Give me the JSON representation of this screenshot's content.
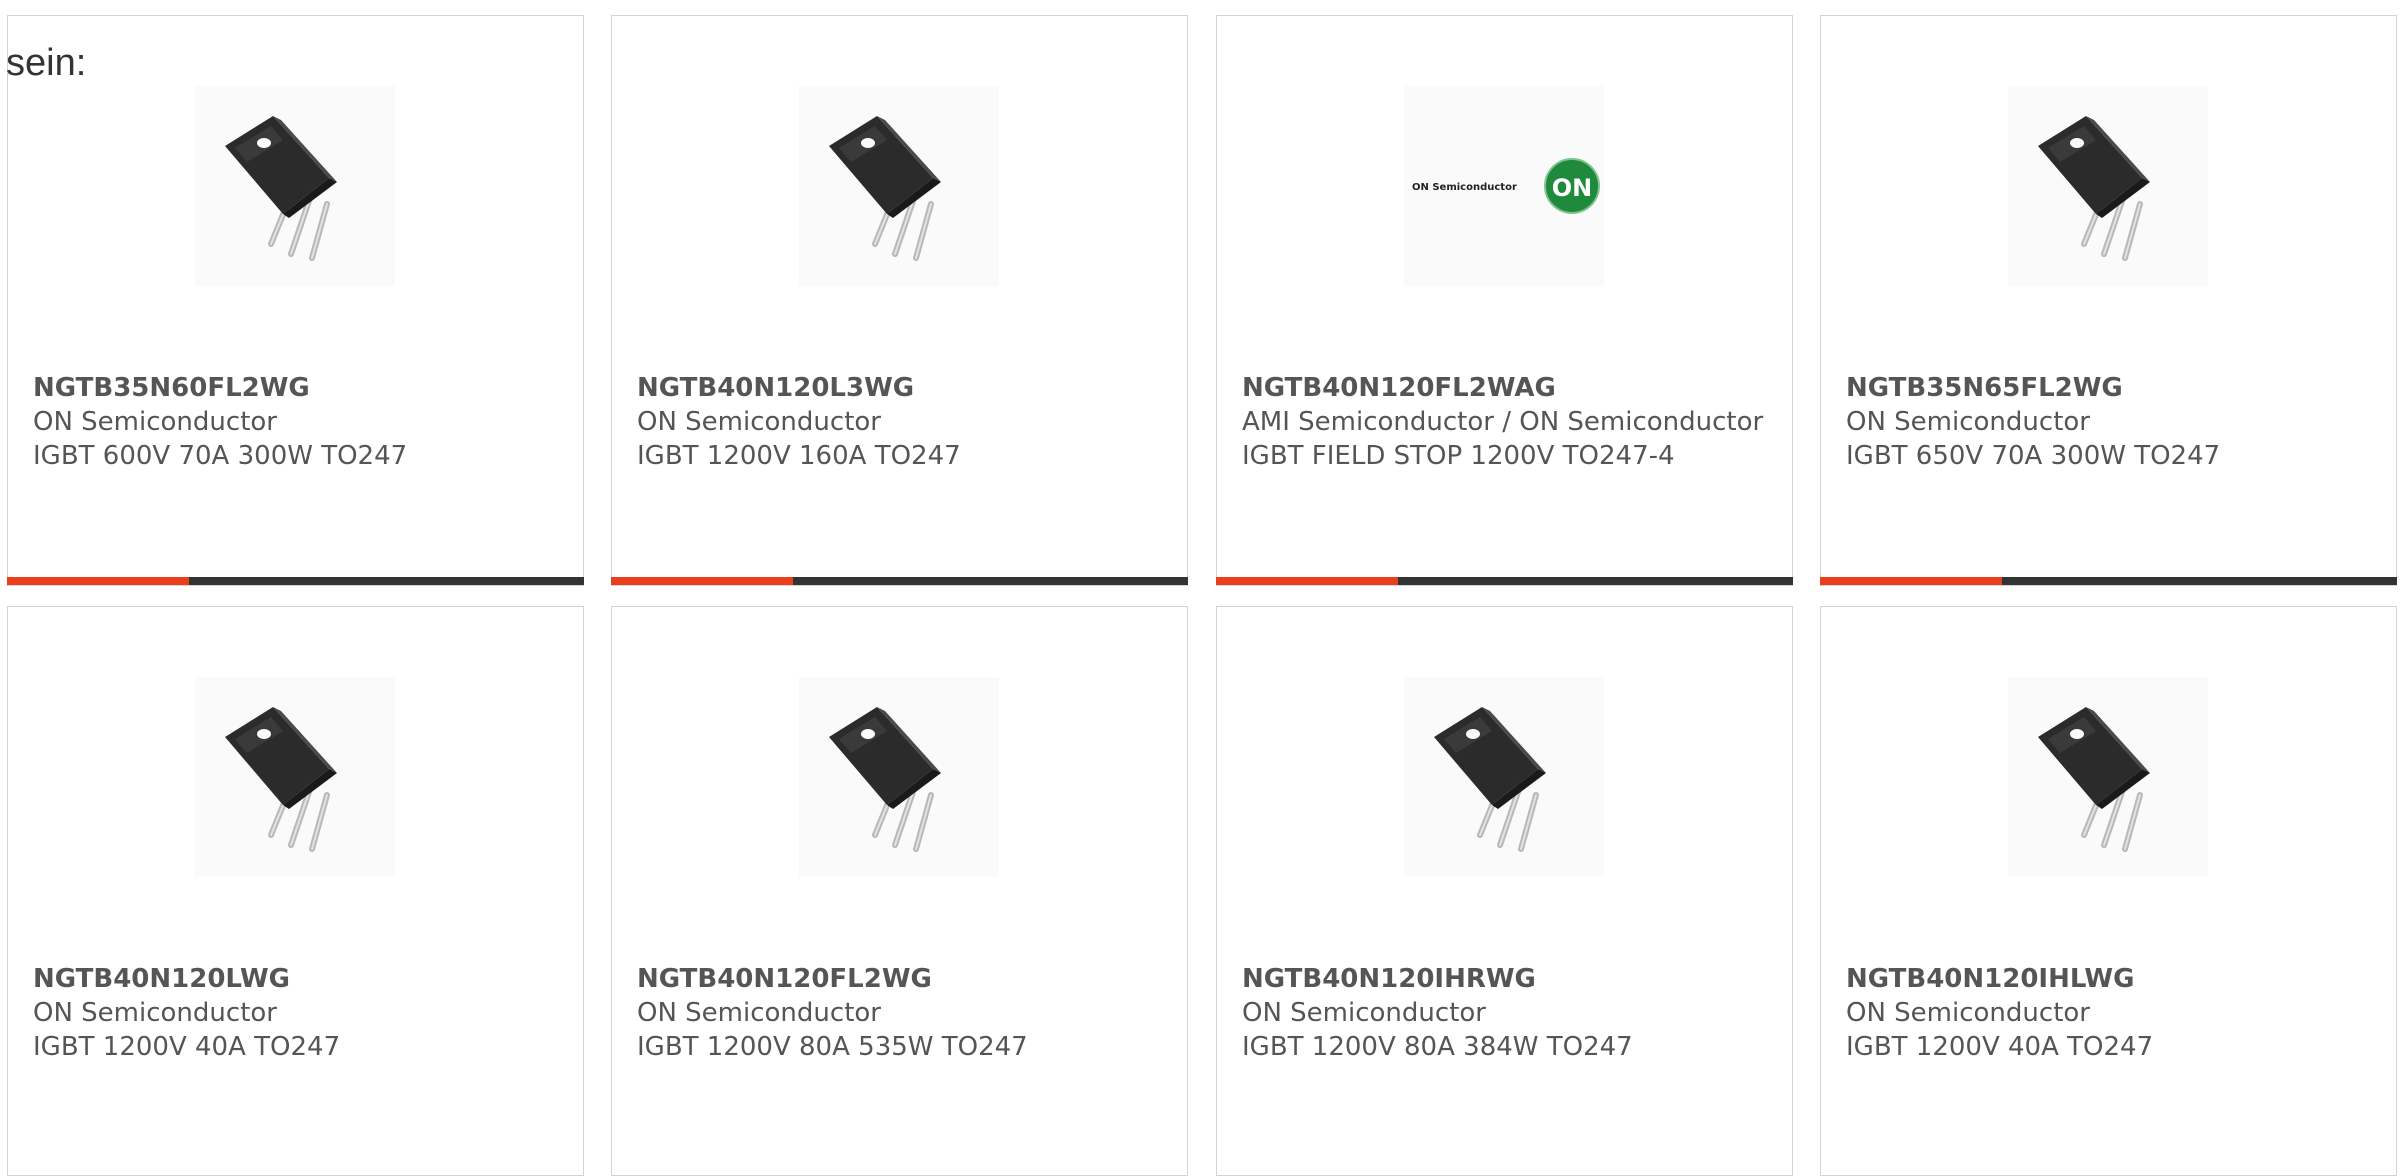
{
  "page": {
    "lead_text": "sein:"
  },
  "colors": {
    "accent": "#e8401c",
    "bar_dark": "#333333",
    "text": "#555555",
    "border": "#d3d3d3",
    "on_logo_green": "#1f8a3c"
  },
  "cards": [
    {
      "part_number": "NGTB35N60FL2WG",
      "manufacturer": "ON Semiconductor",
      "description": "IGBT 600V 70A 300W TO247",
      "image": "to247-transistor-icon"
    },
    {
      "part_number": "NGTB40N120L3WG",
      "manufacturer": "ON Semiconductor",
      "description": "IGBT 1200V 160A TO247",
      "image": "to247-transistor-icon"
    },
    {
      "part_number": "NGTB40N120FL2WAG",
      "manufacturer": "AMI Semiconductor / ON Semiconductor",
      "description": "IGBT FIELD STOP 1200V TO247-4",
      "image": "on-semiconductor-logo",
      "logo_text": "ON Semiconductor",
      "logo_badge": "ON"
    },
    {
      "part_number": "NGTB35N65FL2WG",
      "manufacturer": "ON Semiconductor",
      "description": "IGBT 650V 70A 300W TO247",
      "image": "to247-transistor-icon"
    },
    {
      "part_number": "NGTB40N120LWG",
      "manufacturer": "ON Semiconductor",
      "description": "IGBT 1200V 40A TO247",
      "image": "to247-transistor-icon"
    },
    {
      "part_number": "NGTB40N120FL2WG",
      "manufacturer": "ON Semiconductor",
      "description": "IGBT 1200V 80A 535W TO247",
      "image": "to247-transistor-icon"
    },
    {
      "part_number": "NGTB40N120IHRWG",
      "manufacturer": "ON Semiconductor",
      "description": "IGBT 1200V 80A 384W TO247",
      "image": "to247-transistor-icon"
    },
    {
      "part_number": "NGTB40N120IHLWG",
      "manufacturer": "ON Semiconductor",
      "description": "IGBT 1200V 40A TO247",
      "image": "to247-transistor-icon"
    }
  ]
}
